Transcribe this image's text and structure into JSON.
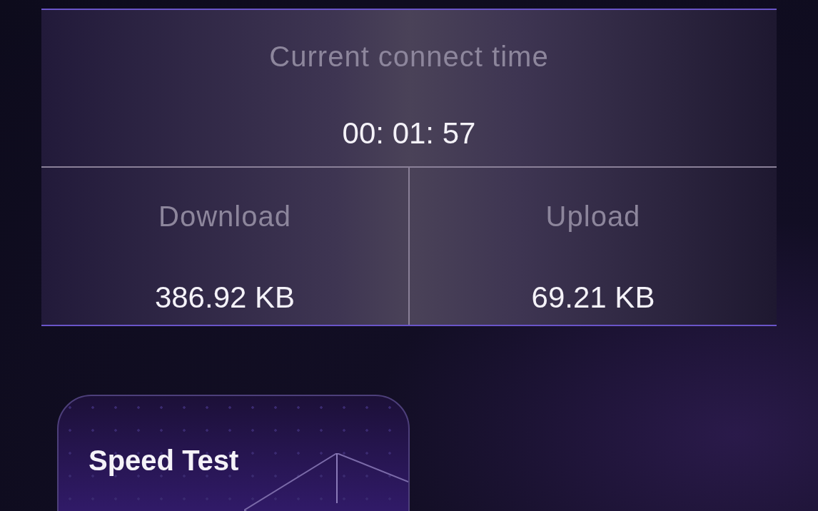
{
  "connect_time": {
    "label": "Current connect time",
    "value": "00: 01: 57"
  },
  "stats": [
    {
      "label": "Download",
      "value": "386.92 KB"
    },
    {
      "label": "Upload",
      "value": "69.21 KB"
    }
  ],
  "speed_test_card": {
    "title": "Speed Test"
  }
}
